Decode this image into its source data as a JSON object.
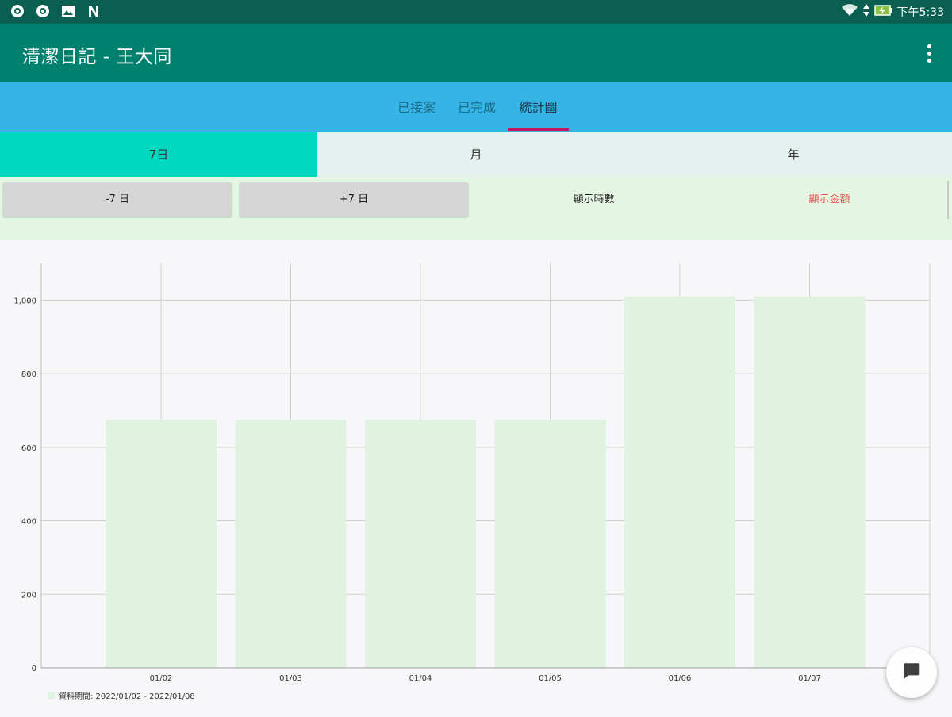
{
  "status_bar": {
    "time": "下午5:33",
    "left_icons": [
      "vpn-icon",
      "vpn-icon",
      "image-icon",
      "n-app-icon"
    ],
    "right_icons": [
      "wifi-icon",
      "data-arrows-icon",
      "battery-charging-icon"
    ]
  },
  "app_bar": {
    "title": "清潔日記 - 王大同",
    "menu_icon": "more-vert-icon"
  },
  "tabs": [
    {
      "label": "已接案"
    },
    {
      "label": "已完成"
    },
    {
      "label": "統計圖",
      "selected": true
    }
  ],
  "range_tabs": [
    {
      "label": "7日",
      "selected": true
    },
    {
      "label": "月"
    },
    {
      "label": "年"
    }
  ],
  "controls": {
    "prev_label": "-7 日",
    "next_label": "+7 日",
    "show_hours_label": "顯示時數",
    "show_amount_label": "顯示金額"
  },
  "chart_data": {
    "type": "bar",
    "categories": [
      "01/02",
      "01/03",
      "01/04",
      "01/05",
      "01/06",
      "01/07"
    ],
    "values": [
      675,
      675,
      675,
      675,
      1010,
      1010
    ],
    "ylim": [
      0,
      1100
    ],
    "y_ticks": [
      0,
      200,
      400,
      600,
      800,
      1000
    ],
    "y_tick_labels": [
      "0",
      "200",
      "400",
      "600",
      "800",
      "1,000"
    ],
    "legend": "資料期間: 2022/01/02 - 2022/01/08",
    "legend_placement": "bottom-left",
    "grid": true,
    "bar_color": "#dff3e0"
  },
  "colors": {
    "status_bar": "#0b5f50",
    "app_bar": "#00806f",
    "tab_bar": "#34b5e6",
    "tab_indicator": "#c2185b",
    "range_active": "#00d9c0",
    "range_inactive": "#e4f1ef",
    "control_panel": "#e3f5e3",
    "amount_label": "#e05a4f"
  },
  "fab": {
    "icon": "chat-icon"
  }
}
